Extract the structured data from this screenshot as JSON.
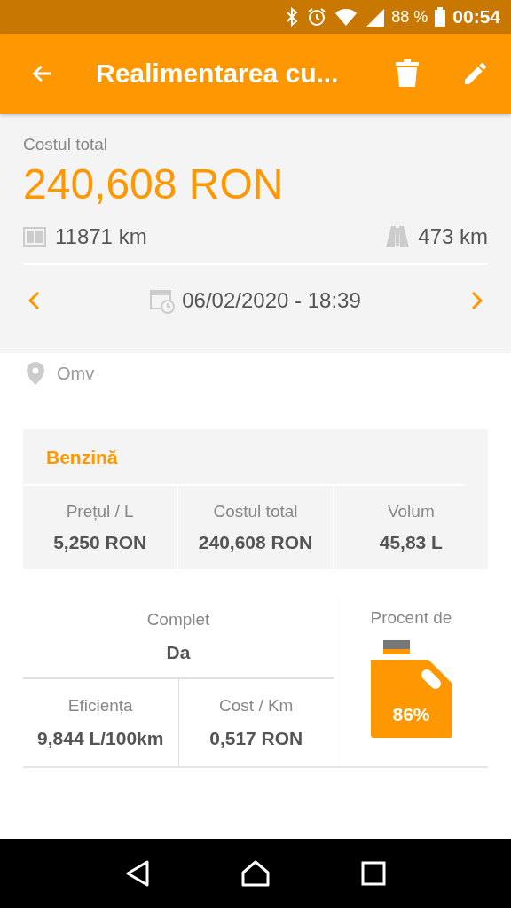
{
  "status_bar": {
    "battery": "88 %",
    "time": "00:54"
  },
  "toolbar": {
    "title": "Realimentarea cu..."
  },
  "summary": {
    "label": "Costul total",
    "total": "240,608 RON",
    "odometer": "11871 km",
    "distance": "473 km",
    "date": "06/02/2020 - 18:39"
  },
  "location": "Omv",
  "fuel_card": {
    "title": "Benzină",
    "columns": [
      {
        "label": "Prețul / L",
        "value": "5,250 RON"
      },
      {
        "label": "Costul total",
        "value": "240,608 RON"
      },
      {
        "label": "Volum",
        "value": "45,83 L"
      }
    ]
  },
  "stats": {
    "complete_label": "Complet",
    "complete_value": "Da",
    "cells": [
      {
        "label": "Eficiența",
        "value": "9,844 L/100km"
      },
      {
        "label": "Cost / Km",
        "value": "0,517 RON"
      }
    ],
    "percent_label": "Procent de",
    "percent": "86%"
  }
}
